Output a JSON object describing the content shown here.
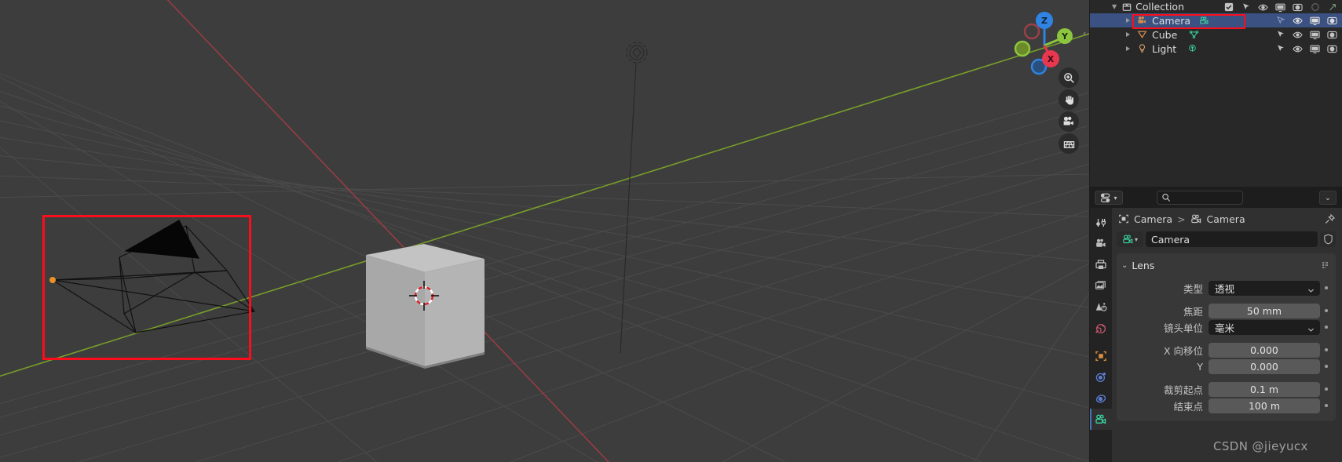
{
  "viewport": {
    "name": "3d-viewport",
    "background_color": "#3d3d3d",
    "grid_color": "#4d4d4d",
    "x_axis_color": "#9b3c45",
    "y_axis_color": "#7ba428",
    "gizmo": {
      "axes": [
        {
          "label": "Z",
          "color": "#2f83e3",
          "filled": true
        },
        {
          "label": "Y",
          "color": "#8cc63f",
          "filled": true
        },
        {
          "label": "X",
          "color": "#e8384f",
          "filled": true
        },
        {
          "label": "",
          "color": "#2f83e3",
          "filled": false
        },
        {
          "label": "",
          "color": "#8cc63f",
          "filled": false
        },
        {
          "label": "",
          "color": "#e8384f",
          "filled": false
        }
      ]
    },
    "tools": [
      {
        "name": "zoom-icon",
        "label": "Zoom"
      },
      {
        "name": "hand-pan-icon",
        "label": "Move View"
      },
      {
        "name": "camera-view-icon",
        "label": "Camera View"
      },
      {
        "name": "ortho-grid-icon",
        "label": "Toggle Orthographic"
      }
    ],
    "objects": [
      {
        "name": "camera-wireframe",
        "label": "Camera",
        "selected": false
      },
      {
        "name": "cube-mesh",
        "label": "Cube",
        "color": "#b4b4b4"
      },
      {
        "name": "light-object",
        "label": "Light"
      },
      {
        "name": "3d-cursor",
        "label": "3D Cursor"
      }
    ],
    "annotation": {
      "name": "red-highlight-camera",
      "color": "#fc0d1c"
    }
  },
  "outliner": {
    "collection": {
      "label": "Collection",
      "icon": "collection-icon",
      "header_icons": [
        "checkbox-checked-icon",
        "cursor-select-icon",
        "eye-icon",
        "monitor-icon",
        "camera-render-icon",
        "circle-icon",
        "arrow-diagonal-icon"
      ]
    },
    "items": [
      {
        "label": "Camera",
        "type_icon": "camera-object-icon",
        "data_icon": "camera-data-icon",
        "selected": true,
        "icons": [
          "cursor-select-icon",
          "eye-icon",
          "monitor-icon",
          "camera-render-icon"
        ],
        "highlighted": true
      },
      {
        "label": "Cube",
        "type_icon": "mesh-object-icon",
        "data_icon": "mesh-data-icon",
        "selected": false,
        "icons": [
          "cursor-select-icon",
          "eye-icon",
          "monitor-icon",
          "camera-render-icon"
        ],
        "highlighted": false
      },
      {
        "label": "Light",
        "type_icon": "light-object-icon",
        "data_icon": "light-data-icon",
        "selected": false,
        "icons": [
          "cursor-select-icon",
          "eye-icon",
          "monitor-icon",
          "camera-render-icon"
        ],
        "highlighted": false
      }
    ]
  },
  "properties": {
    "editor_type_icon": "properties-editor-icon",
    "search_placeholder": "",
    "search_icon": "search-icon",
    "options_chevron": "chevron-down-icon",
    "tabs": [
      {
        "name": "tool-tab",
        "icon": "tool-icon",
        "active": false,
        "color": "#c8c8c8"
      },
      {
        "name": "render-tab",
        "icon": "render-camera-icon",
        "active": false,
        "color": "#c8c8c8"
      },
      {
        "name": "output-tab",
        "icon": "printer-icon",
        "active": false,
        "color": "#c8c8c8"
      },
      {
        "name": "view-layer-tab",
        "icon": "images-icon",
        "active": false,
        "color": "#c8c8c8"
      },
      {
        "name": "scene-tab",
        "icon": "scene-cone-icon",
        "active": false,
        "color": "#c8c8c8"
      },
      {
        "name": "world-tab",
        "icon": "world-globe-icon",
        "active": false,
        "color": "#c2566a"
      },
      {
        "name": "object-tab",
        "icon": "object-square-icon",
        "active": false,
        "color": "#d98e3e"
      },
      {
        "name": "modifiers-tab",
        "icon": "physics-orbit-icon",
        "active": false,
        "color": "#5b7fd4"
      },
      {
        "name": "constraints-tab",
        "icon": "constraint-icon",
        "active": false,
        "color": "#5b7fd4"
      },
      {
        "name": "object-data-tab",
        "icon": "camera-data-icon",
        "active": true,
        "color": "#3ad6a0"
      }
    ],
    "breadcrumb": [
      {
        "label": "Camera",
        "icon": "object-square-icon"
      },
      {
        "label": "Camera",
        "icon": "camera-data-icon"
      }
    ],
    "pin_icon": "pin-icon",
    "id_block": {
      "icon": "camera-data-icon",
      "chevron": "chevron-down-icon",
      "name": "Camera",
      "shield_icon": "fake-user-shield-icon"
    },
    "panels": [
      {
        "title": "Lens",
        "expanded": true,
        "rows": [
          {
            "label": "类型",
            "value": "透视",
            "widget": "dropdown",
            "animatable": true
          },
          {
            "label": "焦距",
            "value": "50 mm",
            "widget": "value",
            "animatable": true,
            "spacer_before": true
          },
          {
            "label": "镜头单位",
            "value": "毫米",
            "widget": "dropdown",
            "animatable": true
          },
          {
            "label": "X 向移位",
            "value": "0.000",
            "widget": "value",
            "animatable": true,
            "spacer_before": true
          },
          {
            "label": "Y",
            "value": "0.000",
            "widget": "value",
            "animatable": true
          },
          {
            "label": "裁剪起点",
            "value": "0.1 m",
            "widget": "value",
            "animatable": true,
            "spacer_before": true
          },
          {
            "label": "结束点",
            "value": "100 m",
            "widget": "value",
            "animatable": true
          }
        ]
      }
    ]
  },
  "watermark": {
    "text": "CSDN @jieyucx"
  }
}
